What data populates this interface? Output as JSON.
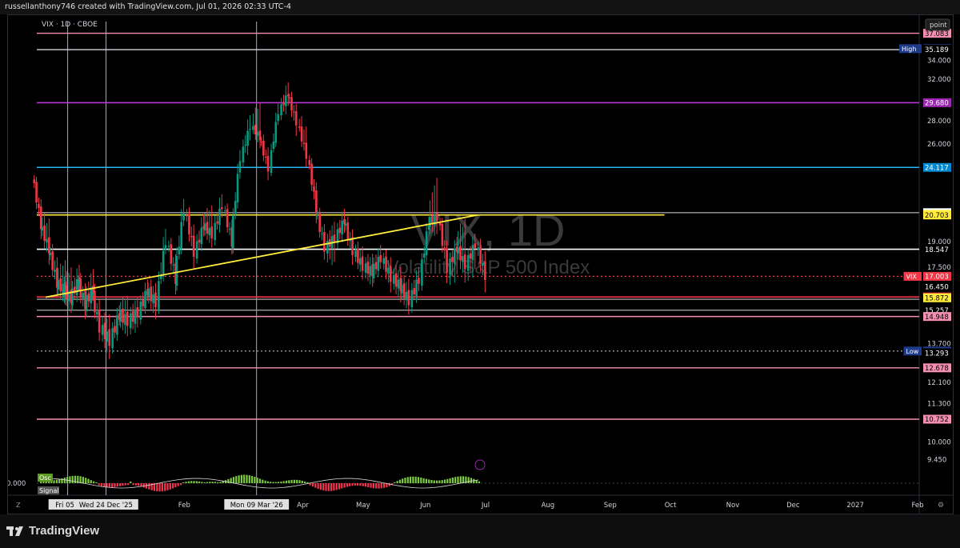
{
  "header": {
    "text": "russellanthony746 created with TradingView.com, Jul 01, 2026 02:33 UTC-4"
  },
  "footer": {
    "brand": "TradingView"
  },
  "chart_data": {
    "type": "candlestick",
    "symbol_line": "VIX · 1D · CBOE",
    "watermark_symbol": "VIX, 1D",
    "watermark_name": "Volatility S&P 500 Index",
    "price_button": "point",
    "y_scale": "log",
    "ylim": [
      9.1,
      38.5
    ],
    "y_ticks": [
      34.0,
      32.0,
      28.0,
      26.0,
      19.0,
      17.5,
      13.7,
      12.1,
      11.3,
      10.0,
      9.45
    ],
    "y_tick_labels": [
      "34.000",
      "32.000",
      "28.000",
      "26.000",
      "19.000",
      "17.500",
      "13.700",
      "12.100",
      "11.300",
      "10.000",
      "9.450"
    ],
    "x_labels": [
      {
        "label": "Feb",
        "x": "2026-02-01"
      },
      {
        "label": "Apr",
        "x": "2026-04-01"
      },
      {
        "label": "May",
        "x": "2026-05-01"
      },
      {
        "label": "Jun",
        "x": "2026-06-01"
      },
      {
        "label": "Jul",
        "x": "2026-07-01"
      },
      {
        "label": "Aug",
        "x": "2026-08-01"
      },
      {
        "label": "Sep",
        "x": "2026-09-01"
      },
      {
        "label": "Oct",
        "x": "2026-10-01"
      },
      {
        "label": "Nov",
        "x": "2026-11-01"
      },
      {
        "label": "Dec",
        "x": "2026-12-01"
      },
      {
        "label": "2027",
        "x": "2027-01-01"
      },
      {
        "label": "Feb",
        "x": "2027-02-01"
      }
    ],
    "x_highlight_labels": [
      {
        "label": "Fri 05 Dec",
        "x": "2025-12-05"
      },
      {
        "label": "Wed 24 Dec '25",
        "x": "2025-12-24"
      },
      {
        "label": "Mon 09 Mar '26",
        "x": "2026-03-09"
      }
    ],
    "vertical_markers": [
      "2025-12-05",
      "2025-12-24",
      "2026-03-09"
    ],
    "levels": [
      {
        "value": 37.083,
        "label": "37.083",
        "color": "#f48fb1",
        "line": "solid",
        "badge": "#f48fb1"
      },
      {
        "value": 35.3,
        "label": "35.300",
        "tag": "High",
        "color": "#9598a1",
        "line": "none",
        "badge": "#1e3a8a"
      },
      {
        "value": 35.189,
        "label": "35.189",
        "color": "#d1d4dc",
        "line": "solid",
        "badge": "#000"
      },
      {
        "value": 29.68,
        "label": "29.680",
        "color": "#c239e0",
        "line": "solid",
        "badge": "#9c27b0"
      },
      {
        "value": 24.117,
        "label": "24.117",
        "color": "#29b6f6",
        "line": "solid",
        "badge": "#0288d1"
      },
      {
        "value": 20.858,
        "label": "20.858",
        "color": "#9e9e9e",
        "line": "solid",
        "badge": "#ffffff"
      },
      {
        "value": 20.741,
        "label": "20.741",
        "color": "#ffeb3b",
        "line": "none",
        "badge": "#ffeb3b"
      },
      {
        "value": 20.703,
        "label": "20.703",
        "color": "#ffeb3b",
        "line": "partial",
        "badge": "#ffeb3b"
      },
      {
        "value": 18.547,
        "label": "18.547",
        "color": "#ffffff",
        "line": "solid",
        "badge": "#000"
      },
      {
        "value": 17.003,
        "label": "17.003",
        "tag": "VIX",
        "color": "#f23645",
        "line": "dotted",
        "badge": "#f23645"
      },
      {
        "value": 16.45,
        "label": "16.450",
        "color": "#f23645",
        "line": "none",
        "badge": "#000"
      },
      {
        "value": 15.916,
        "label": "15.916",
        "color": "#f23645",
        "line": "solid",
        "badge": "#f23645"
      },
      {
        "value": 15.872,
        "label": "15.872",
        "color": "#ffeb3b",
        "line": "none",
        "badge": "#ffeb3b"
      },
      {
        "value": 15.8,
        "label": "",
        "color": "#9e9e9e",
        "line": "solid",
        "badge": ""
      },
      {
        "value": 15.257,
        "label": "15.257",
        "color": "#9e9e9e",
        "line": "solid",
        "badge": "#000"
      },
      {
        "value": 14.948,
        "label": "14.948",
        "color": "#f48fb1",
        "line": "solid",
        "badge": "#f48fb1"
      },
      {
        "value": 13.38,
        "label": "13.380",
        "tag": "Low",
        "color": "#9598a1",
        "line": "dotted",
        "badge": "#1e3a8a"
      },
      {
        "value": 13.293,
        "label": "13.293",
        "color": "#d1d4dc",
        "line": "none",
        "badge": "#000"
      },
      {
        "value": 12.678,
        "label": "12.678",
        "color": "#f48fb1",
        "line": "solid",
        "badge": "#f48fb1"
      },
      {
        "value": 10.752,
        "label": "10.752",
        "color": "#f48fb1",
        "line": "solid",
        "badge": "#f48fb1"
      }
    ],
    "trendlines": [
      {
        "from": {
          "x": "2025-11-24",
          "y": 15.9
        },
        "to": {
          "x": "2026-06-27",
          "y": 20.7
        },
        "color": "#ffeb3b"
      }
    ],
    "ohlc_approx": [
      [
        "2025-11-20",
        23.5,
        23.8,
        19.5,
        20.0
      ],
      [
        "2025-11-24",
        20.0,
        21.0,
        18.0,
        18.5
      ],
      [
        "2025-11-28",
        18.5,
        18.9,
        16.3,
        16.6
      ],
      [
        "2025-12-02",
        16.6,
        17.6,
        15.9,
        16.2
      ],
      [
        "2025-12-05",
        16.2,
        17.2,
        15.5,
        15.8
      ],
      [
        "2025-12-09",
        15.8,
        17.3,
        15.6,
        16.8
      ],
      [
        "2025-12-12",
        16.8,
        17.0,
        15.2,
        15.5
      ],
      [
        "2025-12-16",
        15.5,
        17.0,
        15.3,
        16.3
      ],
      [
        "2025-12-19",
        16.3,
        16.6,
        14.2,
        14.4
      ],
      [
        "2025-12-24",
        14.4,
        14.9,
        13.4,
        13.8
      ],
      [
        "2025-12-29",
        13.8,
        15.2,
        13.7,
        15.0
      ],
      [
        "2026-01-02",
        15.0,
        15.6,
        14.4,
        14.7
      ],
      [
        "2026-01-07",
        14.7,
        15.4,
        14.4,
        15.1
      ],
      [
        "2026-01-12",
        15.1,
        16.5,
        15.0,
        16.2
      ],
      [
        "2026-01-16",
        16.2,
        16.5,
        15.2,
        15.6
      ],
      [
        "2026-01-21",
        15.6,
        19.8,
        15.5,
        19.0
      ],
      [
        "2026-01-26",
        19.0,
        19.3,
        16.4,
        16.8
      ],
      [
        "2026-01-30",
        16.8,
        21.8,
        16.6,
        21.0
      ],
      [
        "2026-02-04",
        21.0,
        21.5,
        17.8,
        18.3
      ],
      [
        "2026-02-09",
        18.3,
        20.6,
        18.0,
        20.0
      ],
      [
        "2026-02-13",
        20.0,
        21.2,
        19.0,
        19.4
      ],
      [
        "2026-02-18",
        19.4,
        22.0,
        19.0,
        21.3
      ],
      [
        "2026-02-23",
        21.3,
        21.6,
        18.6,
        18.9
      ],
      [
        "2026-02-27",
        18.9,
        25.5,
        18.6,
        24.8
      ],
      [
        "2026-03-04",
        24.8,
        28.5,
        24.0,
        27.5
      ],
      [
        "2026-03-09",
        27.5,
        29.8,
        26.0,
        26.5
      ],
      [
        "2026-03-13",
        26.5,
        27.0,
        23.5,
        24.0
      ],
      [
        "2026-03-18",
        24.0,
        29.6,
        23.8,
        28.8
      ],
      [
        "2026-03-23",
        28.8,
        31.5,
        28.0,
        30.5
      ],
      [
        "2026-03-27",
        30.5,
        31.0,
        27.0,
        27.8
      ],
      [
        "2026-04-01",
        27.8,
        29.0,
        24.5,
        25.0
      ],
      [
        "2026-04-06",
        25.0,
        25.4,
        20.5,
        21.0
      ],
      [
        "2026-04-10",
        21.0,
        21.3,
        18.3,
        18.6
      ],
      [
        "2026-04-15",
        18.6,
        19.8,
        17.5,
        19.2
      ],
      [
        "2026-04-20",
        19.2,
        20.8,
        18.8,
        20.3
      ],
      [
        "2026-04-24",
        20.3,
        20.6,
        18.0,
        18.4
      ],
      [
        "2026-04-29",
        18.4,
        18.8,
        17.2,
        17.5
      ],
      [
        "2026-05-04",
        17.5,
        17.9,
        16.8,
        17.2
      ],
      [
        "2026-05-08",
        17.2,
        18.4,
        17.0,
        18.0
      ],
      [
        "2026-05-13",
        18.0,
        18.3,
        16.5,
        16.9
      ],
      [
        "2026-05-18",
        16.9,
        17.3,
        16.0,
        16.4
      ],
      [
        "2026-05-22",
        16.4,
        16.8,
        15.4,
        15.7
      ],
      [
        "2026-05-27",
        15.7,
        17.2,
        15.5,
        16.8
      ],
      [
        "2026-06-01",
        16.8,
        20.6,
        16.6,
        20.2
      ],
      [
        "2026-06-05",
        20.2,
        22.8,
        19.5,
        20.5
      ],
      [
        "2026-06-10",
        20.5,
        20.8,
        17.0,
        17.4
      ],
      [
        "2026-06-15",
        17.4,
        19.0,
        16.2,
        18.6
      ],
      [
        "2026-06-19",
        18.6,
        20.6,
        17.0,
        17.6
      ],
      [
        "2026-06-24",
        17.6,
        19.2,
        16.5,
        18.8
      ],
      [
        "2026-06-29",
        18.8,
        19.2,
        16.5,
        17.0
      ]
    ],
    "indicator": {
      "legend": [
        "Osc",
        "Signal"
      ],
      "value_label": "0.000"
    }
  }
}
